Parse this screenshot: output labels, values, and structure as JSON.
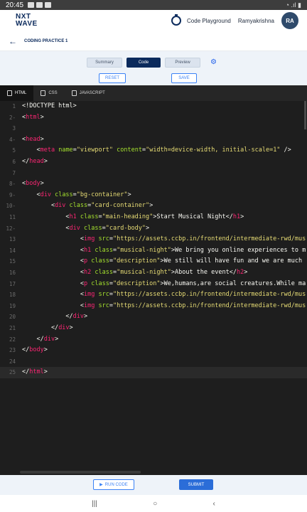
{
  "status_bar": {
    "time": "20:45",
    "right_indicators": "◔ .ıl ▮"
  },
  "brand": {
    "line1": "NXT",
    "line2": "WAVE"
  },
  "top_nav": {
    "playground_label": "Code Playground",
    "user_name": "Ramyakrishna",
    "avatar_initials": "RA"
  },
  "breadcrumb": {
    "title": "CODING PRACTICE 1"
  },
  "view_tabs": [
    {
      "label": "Summary"
    },
    {
      "label": "Code"
    },
    {
      "label": "Preview"
    }
  ],
  "active_view": "Code",
  "actions": {
    "reset_label": "RESET",
    "save_label": "SAVE"
  },
  "editor_tabs": [
    {
      "label": "HTML"
    },
    {
      "label": "CSS"
    },
    {
      "label": "JAVASCRIPT"
    }
  ],
  "active_editor_tab": "HTML",
  "code_lines": [
    {
      "n": "1",
      "fold": "",
      "parts": [
        [
          "tx",
          "<!DOCTYPE html>"
        ]
      ]
    },
    {
      "n": "2",
      "fold": "-",
      "parts": [
        [
          "tx",
          "<"
        ],
        [
          "tg",
          "html"
        ],
        [
          "tx",
          ">"
        ]
      ]
    },
    {
      "n": "3",
      "fold": "",
      "parts": []
    },
    {
      "n": "4",
      "fold": "-",
      "parts": [
        [
          "tx",
          "<"
        ],
        [
          "tg",
          "head"
        ],
        [
          "tx",
          ">"
        ]
      ]
    },
    {
      "n": "5",
      "fold": "",
      "parts": [
        [
          "tx",
          "    <"
        ],
        [
          "tg",
          "meta"
        ],
        [
          "tx",
          " "
        ],
        [
          "at",
          "name"
        ],
        [
          "tx",
          "="
        ],
        [
          "st",
          "\"viewport\""
        ],
        [
          "tx",
          " "
        ],
        [
          "at",
          "content"
        ],
        [
          "tx",
          "="
        ],
        [
          "st",
          "\"width=device-width, initial-scale=1\""
        ],
        [
          "tx",
          " />"
        ]
      ]
    },
    {
      "n": "6",
      "fold": "",
      "parts": [
        [
          "tx",
          "</"
        ],
        [
          "tg",
          "head"
        ],
        [
          "tx",
          ">"
        ]
      ]
    },
    {
      "n": "7",
      "fold": "",
      "parts": []
    },
    {
      "n": "8",
      "fold": "-",
      "parts": [
        [
          "tx",
          "<"
        ],
        [
          "tg",
          "body"
        ],
        [
          "tx",
          ">"
        ]
      ]
    },
    {
      "n": "9",
      "fold": "-",
      "parts": [
        [
          "tx",
          "    <"
        ],
        [
          "tg",
          "div"
        ],
        [
          "tx",
          " "
        ],
        [
          "at",
          "class"
        ],
        [
          "tx",
          "="
        ],
        [
          "st",
          "\"bg-container\""
        ],
        [
          "tx",
          ">"
        ]
      ]
    },
    {
      "n": "10",
      "fold": "-",
      "parts": [
        [
          "tx",
          "        <"
        ],
        [
          "tg",
          "div"
        ],
        [
          "tx",
          " "
        ],
        [
          "at",
          "class"
        ],
        [
          "tx",
          "="
        ],
        [
          "st",
          "\"card-container\""
        ],
        [
          "tx",
          ">"
        ]
      ]
    },
    {
      "n": "11",
      "fold": "",
      "parts": [
        [
          "tx",
          "            <"
        ],
        [
          "tg",
          "h1"
        ],
        [
          "tx",
          " "
        ],
        [
          "at",
          "class"
        ],
        [
          "tx",
          "="
        ],
        [
          "st",
          "\"main-heading\""
        ],
        [
          "tx",
          ">Start Musical Night</"
        ],
        [
          "tg",
          "h1"
        ],
        [
          "tx",
          ">"
        ]
      ]
    },
    {
      "n": "12",
      "fold": "-",
      "parts": [
        [
          "tx",
          "            <"
        ],
        [
          "tg",
          "div"
        ],
        [
          "tx",
          " "
        ],
        [
          "at",
          "class"
        ],
        [
          "tx",
          "="
        ],
        [
          "st",
          "\"card-body\""
        ],
        [
          "tx",
          ">"
        ]
      ]
    },
    {
      "n": "13",
      "fold": "",
      "parts": [
        [
          "tx",
          "                <"
        ],
        [
          "tg",
          "img"
        ],
        [
          "tx",
          " "
        ],
        [
          "at",
          "src"
        ],
        [
          "tx",
          "="
        ],
        [
          "st",
          "\"https://assets.ccbp.in/frontend/intermediate-rwd/mus"
        ]
      ]
    },
    {
      "n": "14",
      "fold": "",
      "parts": [
        [
          "tx",
          "                <"
        ],
        [
          "tg",
          "h1"
        ],
        [
          "tx",
          " "
        ],
        [
          "at",
          "class"
        ],
        [
          "tx",
          "="
        ],
        [
          "st",
          "\"musical-night\""
        ],
        [
          "tx",
          ">We bring you online experiences to m"
        ]
      ]
    },
    {
      "n": "15",
      "fold": "",
      "parts": [
        [
          "tx",
          "                <"
        ],
        [
          "tg",
          "p"
        ],
        [
          "tx",
          " "
        ],
        [
          "at",
          "class"
        ],
        [
          "tx",
          "="
        ],
        [
          "st",
          "\"description\""
        ],
        [
          "tx",
          ">We still will have fun and we are much"
        ]
      ]
    },
    {
      "n": "16",
      "fold": "",
      "parts": [
        [
          "tx",
          "                <"
        ],
        [
          "tg",
          "h2"
        ],
        [
          "tx",
          " "
        ],
        [
          "at",
          "class"
        ],
        [
          "tx",
          "="
        ],
        [
          "st",
          "\"musical-night\""
        ],
        [
          "tx",
          ">About the event</"
        ],
        [
          "tg",
          "h2"
        ],
        [
          "tx",
          ">"
        ]
      ]
    },
    {
      "n": "17",
      "fold": "",
      "parts": [
        [
          "tx",
          "                <"
        ],
        [
          "tg",
          "p"
        ],
        [
          "tx",
          " "
        ],
        [
          "at",
          "class"
        ],
        [
          "tx",
          "="
        ],
        [
          "st",
          "\"description\""
        ],
        [
          "tx",
          ">We,humans,are social creatures.While ma"
        ]
      ]
    },
    {
      "n": "18",
      "fold": "",
      "parts": [
        [
          "tx",
          "                <"
        ],
        [
          "tg",
          "img"
        ],
        [
          "tx",
          " "
        ],
        [
          "at",
          "src"
        ],
        [
          "tx",
          "="
        ],
        [
          "st",
          "\"https://assets.ccbp.in/frontend/intermediate-rwd/mus"
        ]
      ]
    },
    {
      "n": "19",
      "fold": "",
      "parts": [
        [
          "tx",
          "                <"
        ],
        [
          "tg",
          "img"
        ],
        [
          "tx",
          " "
        ],
        [
          "at",
          "src"
        ],
        [
          "tx",
          "="
        ],
        [
          "st",
          "\"https://assets.ccbp.in/frontend/intermediate-rwd/mus"
        ]
      ]
    },
    {
      "n": "20",
      "fold": "",
      "parts": [
        [
          "tx",
          "            </"
        ],
        [
          "tg",
          "div"
        ],
        [
          "tx",
          ">"
        ]
      ]
    },
    {
      "n": "21",
      "fold": "",
      "parts": [
        [
          "tx",
          "        </"
        ],
        [
          "tg",
          "div"
        ],
        [
          "tx",
          ">"
        ]
      ]
    },
    {
      "n": "22",
      "fold": "",
      "parts": [
        [
          "tx",
          "    </"
        ],
        [
          "tg",
          "div"
        ],
        [
          "tx",
          ">"
        ]
      ]
    },
    {
      "n": "23",
      "fold": "",
      "parts": [
        [
          "tx",
          "</"
        ],
        [
          "tg",
          "body"
        ],
        [
          "tx",
          ">"
        ]
      ]
    },
    {
      "n": "24",
      "fold": "",
      "parts": []
    },
    {
      "n": "25",
      "fold": "",
      "parts": [
        [
          "tx",
          "</"
        ],
        [
          "tg",
          "html"
        ],
        [
          "tx",
          ">"
        ]
      ]
    }
  ],
  "current_line": "25",
  "bottom": {
    "run_label": "RUN CODE",
    "submit_label": "SUBMIT"
  },
  "icons": {
    "back": "arrow-left-icon",
    "stopwatch": "stopwatch-icon",
    "settings": "gear-icon",
    "run": "play-icon",
    "android_recents": "recents-icon",
    "android_home": "home-icon",
    "android_back": "back-icon"
  },
  "colors": {
    "brand_navy": "#0b2a5c",
    "accent_blue": "#3b82f6",
    "editor_bg": "#1e1e1e",
    "tag": "#f92672",
    "attribute": "#a6e22e",
    "string": "#e6db74"
  }
}
